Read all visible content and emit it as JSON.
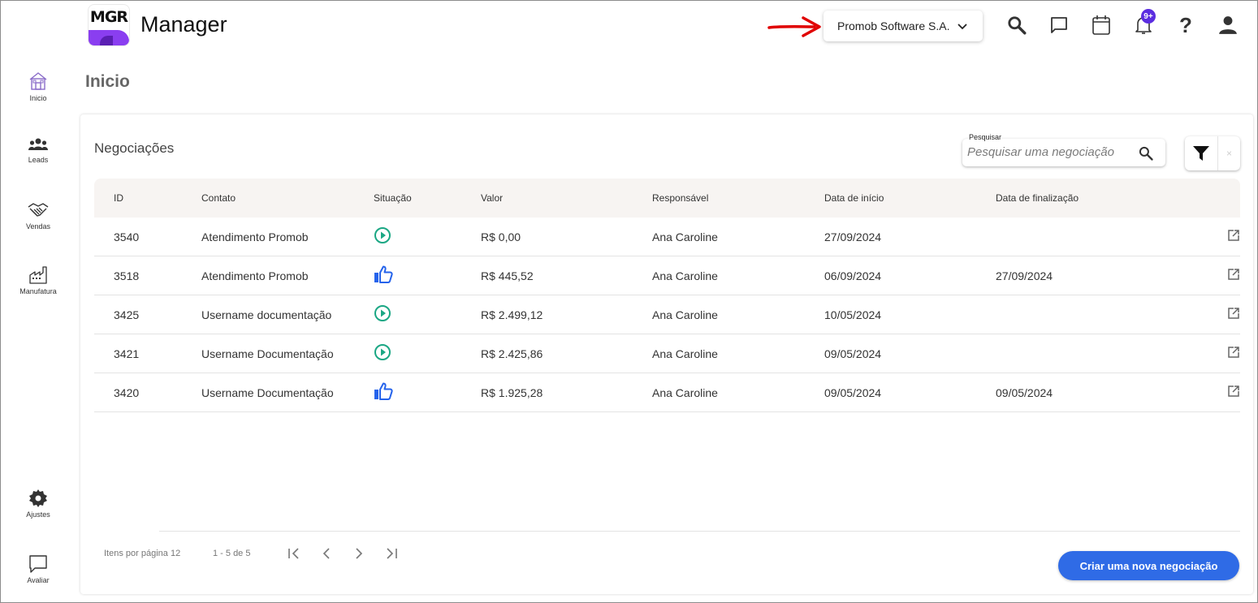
{
  "app": {
    "logo_text": "MGR",
    "name": "Manager"
  },
  "header": {
    "company": "Promob Software S.A.",
    "notification_badge": "9+",
    "help_glyph": "?",
    "icons": [
      "search-icon",
      "chat-icon",
      "calendar-icon",
      "bell-icon",
      "help-icon",
      "user-icon"
    ]
  },
  "sidebar": {
    "items": [
      {
        "label": "Inicio",
        "icon": "home-icon"
      },
      {
        "label": "Leads",
        "icon": "group-icon"
      },
      {
        "label": "Vendas",
        "icon": "handshake-icon"
      },
      {
        "label": "Manufatura",
        "icon": "factory-icon"
      }
    ],
    "bottom": [
      {
        "label": "Ajustes",
        "icon": "gear-icon"
      },
      {
        "label": "Avaliar",
        "icon": "feedback-icon"
      }
    ]
  },
  "page": {
    "title": "Inicio"
  },
  "card": {
    "title": "Negociações",
    "search_label": "Pesquisar",
    "search_placeholder": "Pesquisar uma negociação",
    "clear_glyph": "×"
  },
  "table": {
    "columns": [
      "ID",
      "Contato",
      "Situação",
      "Valor",
      "Responsável",
      "Data de início",
      "Data de finalização"
    ],
    "rows": [
      {
        "id": "3540",
        "contato": "Atendimento Promob",
        "situacao": "em-andamento",
        "valor": "R$ 0,00",
        "responsavel": "Ana Caroline",
        "inicio": "27/09/2024",
        "fim": ""
      },
      {
        "id": "3518",
        "contato": "Atendimento Promob",
        "situacao": "ganha",
        "valor": "R$ 445,52",
        "responsavel": "Ana Caroline",
        "inicio": "06/09/2024",
        "fim": "27/09/2024"
      },
      {
        "id": "3425",
        "contato": "Username documentação",
        "situacao": "em-andamento",
        "valor": "R$ 2.499,12",
        "responsavel": "Ana Caroline",
        "inicio": "10/05/2024",
        "fim": ""
      },
      {
        "id": "3421",
        "contato": "Username Documentação",
        "situacao": "em-andamento",
        "valor": "R$ 2.425,86",
        "responsavel": "Ana Caroline",
        "inicio": "09/05/2024",
        "fim": ""
      },
      {
        "id": "3420",
        "contato": "Username Documentação",
        "situacao": "ganha",
        "valor": "R$ 1.925,28",
        "responsavel": "Ana Caroline",
        "inicio": "09/05/2024",
        "fim": "09/05/2024"
      }
    ]
  },
  "pagination": {
    "items_per_page": "Itens por página 12",
    "range": "1 - 5 de 5",
    "buttons": [
      "first-page-icon",
      "previous-page-icon",
      "next-page-icon",
      "last-page-icon"
    ]
  },
  "cta": {
    "label": "Criar uma nova negociação"
  },
  "colors": {
    "accent": "#2f6be6",
    "logo_purple": "#8a3ef0",
    "status_play": "#1ba784",
    "status_won": "#2563eb",
    "annotation_arrow": "#e00000",
    "badge": "#5b2de0"
  }
}
